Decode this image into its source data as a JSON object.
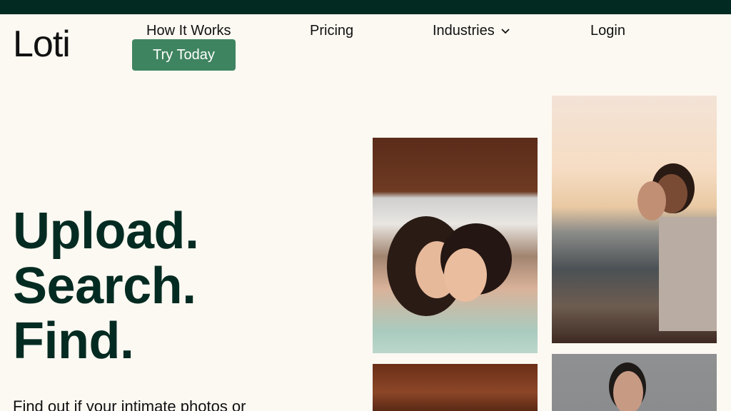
{
  "header": {
    "logo": "Loti",
    "nav": {
      "how_it_works": "How It Works",
      "pricing": "Pricing",
      "industries": "Industries",
      "login": "Login"
    },
    "cta": "Try Today"
  },
  "hero": {
    "line1": "Upload.",
    "line2": "Search.",
    "line3": "Find.",
    "subtitle": "Find out if your intimate photos or"
  },
  "colors": {
    "topbar": "#032a22",
    "background": "#fcf9f2",
    "cta": "#3f8460",
    "hero_text": "#042b22"
  }
}
